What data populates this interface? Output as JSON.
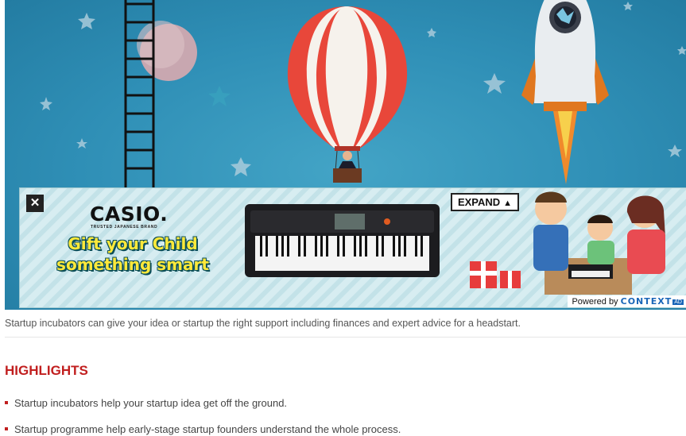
{
  "ad": {
    "close_label": "✕",
    "expand_label": "EXPAND",
    "brand": "CASIO.",
    "brand_tagline": "TRUSTED JAPANESE BRAND",
    "tagline_line1": "Gift your Child",
    "tagline_line2": "something smart",
    "powered_by": "Powered by",
    "powered_brand": "CONTEXT",
    "powered_tag": "AD"
  },
  "article": {
    "caption": "Startup incubators can give your idea or startup the right support including finances and expert advice for a headstart.",
    "highlights_title": "HIGHLIGHTS",
    "highlights": [
      "Startup incubators help your startup idea get off the ground.",
      "Startup programme help early-stage startup founders understand the whole process."
    ]
  },
  "icons": {
    "close": "close-icon",
    "expand": "chevron-up-icon",
    "bullet": "square-bullet-icon"
  },
  "colors": {
    "sky": "#2f8fb6",
    "highlight_red": "#c11f1f",
    "ad_yellow": "#ffe93a",
    "context_blue": "#1a66b8"
  }
}
